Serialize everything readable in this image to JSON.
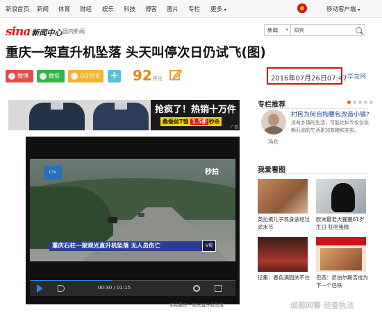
{
  "topnav": {
    "links": [
      "新浪首页",
      "新闻",
      "体育",
      "财经",
      "娱乐",
      "科技",
      "博客",
      "图片",
      "专栏",
      "更多"
    ],
    "mobile": "移动客户端"
  },
  "logo": {
    "brand": "sina",
    "center": "新闻中心"
  },
  "breadcrumb": "国内新闻",
  "search": {
    "category": "新闻",
    "value": "郑爽"
  },
  "article": {
    "title": "重庆一架直升机坠落 头天叫停次日仍试飞(图)",
    "share": {
      "weibo": "微博",
      "weixin": "微信",
      "qq": "QQ空间",
      "plus": "+"
    },
    "comment_count": "92",
    "comment_label": "评论",
    "date": "2016年07月26日07:47",
    "source": "华龙网"
  },
  "ad": {
    "headline": "抢疯了！热销十万件",
    "strip_left": "桑蚕丝T恤",
    "strip_price": "1.5折",
    "strip_right": "秒杀",
    "tag": "广告"
  },
  "video": {
    "caption_bar": "重庆石柱一架观光直升机坠落 无人员伤亡",
    "caption_badge": "V视",
    "tv_logo": "CTV",
    "watermark": "秒拍",
    "time": "00:30 / 01:15",
    "progress": 0.4,
    "caption": "实拍重庆一观光直升机坠落"
  },
  "sidebar": {
    "column_title": "专栏推荐",
    "author": "冯仑",
    "rec_title": "村民为何自掏腰包改造小镇?",
    "rec_desc": "没有乡镇的生活，可能比如今仅仅依赖石油的生活更加有趣和充实。",
    "mylove_title": "我爱看图",
    "thumbs": [
      {
        "caption": "英拉携儿子现身途经过淤水节"
      },
      {
        "caption": "欧洲最老大猩猩61岁生日 狂吃蛋糕"
      },
      {
        "caption": "征集：春色满园关不住"
      },
      {
        "caption": "巴西：尼伯尔殿否成为下一个巴铁"
      }
    ]
  },
  "page_watermark": "成都网警 巡查执法",
  "colors": {
    "brand_red": "#e4161c",
    "highlight_box": "#c6171e",
    "comment_orange": "#e88a10",
    "source_blue": "#4d6fa8"
  }
}
